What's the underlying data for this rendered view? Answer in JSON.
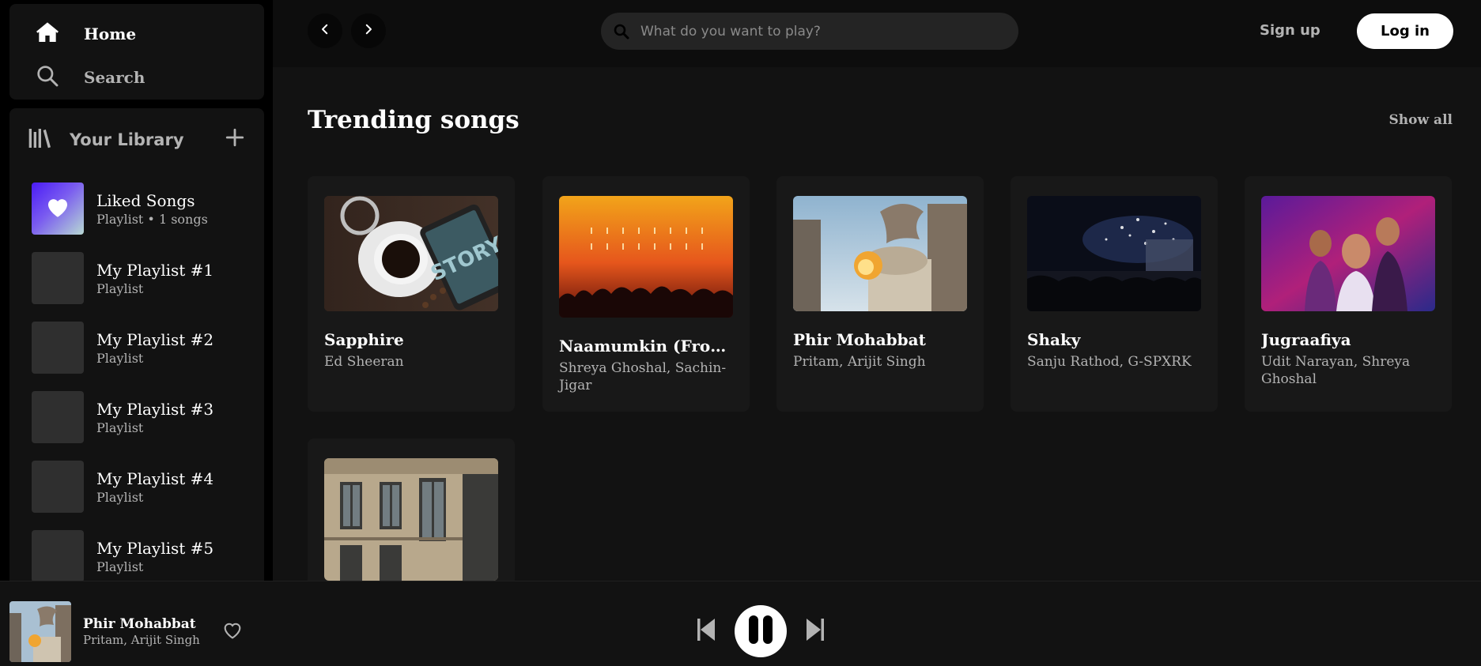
{
  "nav": {
    "home": "Home",
    "search": "Search"
  },
  "library": {
    "title": "Your Library",
    "items": [
      {
        "title": "Liked Songs",
        "subtitle": "Playlist • 1 songs"
      },
      {
        "title": "My Playlist #1",
        "subtitle": "Playlist"
      },
      {
        "title": "My Playlist #2",
        "subtitle": "Playlist"
      },
      {
        "title": "My Playlist #3",
        "subtitle": "Playlist"
      },
      {
        "title": "My Playlist #4",
        "subtitle": "Playlist"
      },
      {
        "title": "My Playlist #5",
        "subtitle": "Playlist"
      }
    ]
  },
  "topbar": {
    "search_placeholder": "What do you want to play?",
    "signup": "Sign up",
    "login": "Log in"
  },
  "section": {
    "title": "Trending songs",
    "show_all": "Show all",
    "cards": [
      {
        "title": "Sapphire",
        "artist": "Ed Sheeran"
      },
      {
        "title": "Naamumkin (From …",
        "artist": "Shreya Ghoshal, Sachin-Jigar"
      },
      {
        "title": "Phir Mohabbat",
        "artist": "Pritam, Arijit Singh"
      },
      {
        "title": "Shaky",
        "artist": "Sanju Rathod, G-SPXRK"
      },
      {
        "title": "Jugraafiya",
        "artist": "Udit Narayan, Shreya Ghoshal"
      },
      {
        "title": "",
        "artist": ""
      }
    ]
  },
  "player": {
    "title": "Phir Mohabbat",
    "artist": "Pritam, Arijit Singh",
    "state": "playing"
  },
  "icons": {
    "home": "home-icon",
    "search": "search-icon",
    "library": "library-icon",
    "add": "plus-icon",
    "heart": "heart-icon",
    "back": "chevron-left-icon",
    "forward": "chevron-right-icon",
    "prev": "skip-previous-icon",
    "pause": "pause-icon",
    "next": "skip-next-icon"
  },
  "colors": {
    "background": "#121212",
    "sidebar": "#000000",
    "accent": "#ffffff",
    "muted": "#b3b3b3"
  }
}
